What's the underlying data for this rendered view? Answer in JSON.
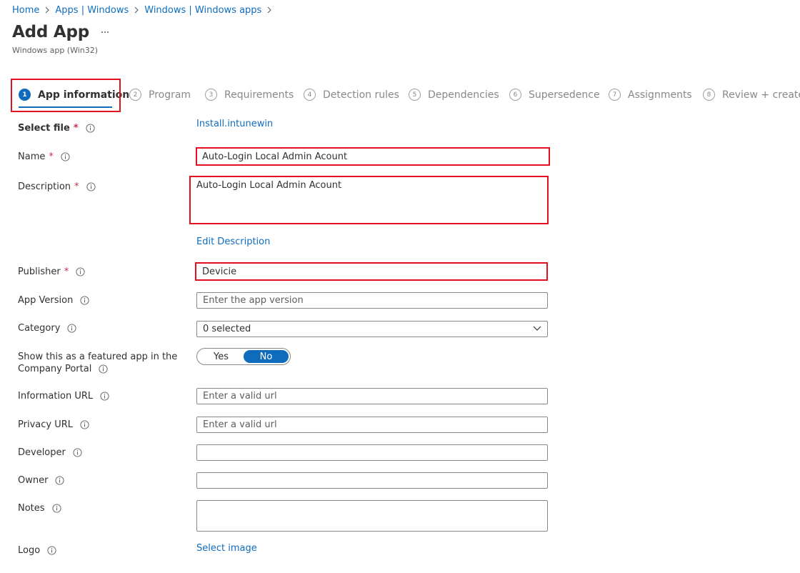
{
  "breadcrumb": [
    "Home",
    "Apps | Windows",
    "Windows | Windows apps"
  ],
  "header": {
    "title": "Add App",
    "more_label": "...",
    "subtitle": "Windows app (Win32)"
  },
  "tabs": [
    {
      "num": "1",
      "label": "App information",
      "active": true
    },
    {
      "num": "2",
      "label": "Program"
    },
    {
      "num": "3",
      "label": "Requirements"
    },
    {
      "num": "4",
      "label": "Detection rules"
    },
    {
      "num": "5",
      "label": "Dependencies"
    },
    {
      "num": "6",
      "label": "Supersedence"
    },
    {
      "num": "7",
      "label": "Assignments"
    },
    {
      "num": "8",
      "label": "Review + create"
    }
  ],
  "form": {
    "select_file": {
      "label": "Select file",
      "value": "Install.intunewin"
    },
    "name": {
      "label": "Name",
      "value": "Auto-Login Local Admin Acount"
    },
    "description": {
      "label": "Description",
      "value": "Auto-Login Local Admin Acount",
      "edit_link": "Edit Description"
    },
    "publisher": {
      "label": "Publisher",
      "value": "Devicie"
    },
    "app_version": {
      "label": "App Version",
      "placeholder": "Enter the app version"
    },
    "category": {
      "label": "Category",
      "value": "0 selected"
    },
    "featured": {
      "label_line1": "Show this as a featured app in the",
      "label_line2": "Company Portal",
      "yes": "Yes",
      "no": "No",
      "selected": "No"
    },
    "information_url": {
      "label": "Information URL",
      "placeholder": "Enter a valid url"
    },
    "privacy_url": {
      "label": "Privacy URL",
      "placeholder": "Enter a valid url"
    },
    "developer": {
      "label": "Developer",
      "value": ""
    },
    "owner": {
      "label": "Owner",
      "value": ""
    },
    "notes": {
      "label": "Notes",
      "value": ""
    },
    "logo": {
      "label": "Logo",
      "link": "Select image"
    }
  },
  "required_marker": "*",
  "colors": {
    "accent": "#0f6cbd",
    "highlight": "#e3101f",
    "required": "#c4314b"
  }
}
